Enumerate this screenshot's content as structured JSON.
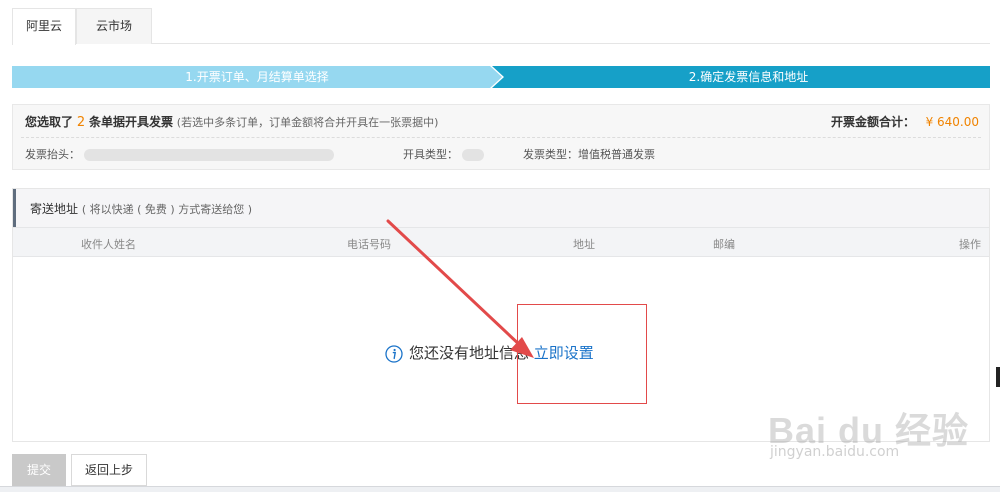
{
  "tabs": [
    {
      "label": "阿里云",
      "active": true
    },
    {
      "label": "云市场",
      "active": false
    }
  ],
  "steps": [
    {
      "label": "1.开票订单、月结算单选择",
      "color": "#96d8f0"
    },
    {
      "label": "2.确定发票信息和地址",
      "color": "#16a0c8"
    }
  ],
  "summary": {
    "selected_prefix": "您选取了",
    "selected_count": "2",
    "selected_suffix": "条单据开具发票",
    "note": "(若选中多条订单，订单金额将合并开具在一张票据中)",
    "total_label": "开票金额合计：",
    "total_value": "¥ 640.00",
    "invoice_title_label": "发票抬头：",
    "issue_type_label": "开具类型：",
    "invoice_type_label": "发票类型：",
    "invoice_type_value": "增值税普通发票"
  },
  "address": {
    "title": "寄送地址",
    "title_note": "( 将以快递 ( 免费 ) 方式寄送给您 )",
    "columns": [
      "收件人姓名",
      "电话号码",
      "地址",
      "邮编",
      "操作"
    ],
    "empty_text": "您还没有地址信息",
    "set_link": "立即设置"
  },
  "buttons": {
    "submit": "提交",
    "back": "返回上步"
  },
  "watermark": {
    "big": "Bai du 经验",
    "small": "jingyan.baidu.com"
  },
  "colors": {
    "accent_orange": "#f08300",
    "link_blue": "#1a73c9",
    "annotation_red": "#e24a4a"
  }
}
